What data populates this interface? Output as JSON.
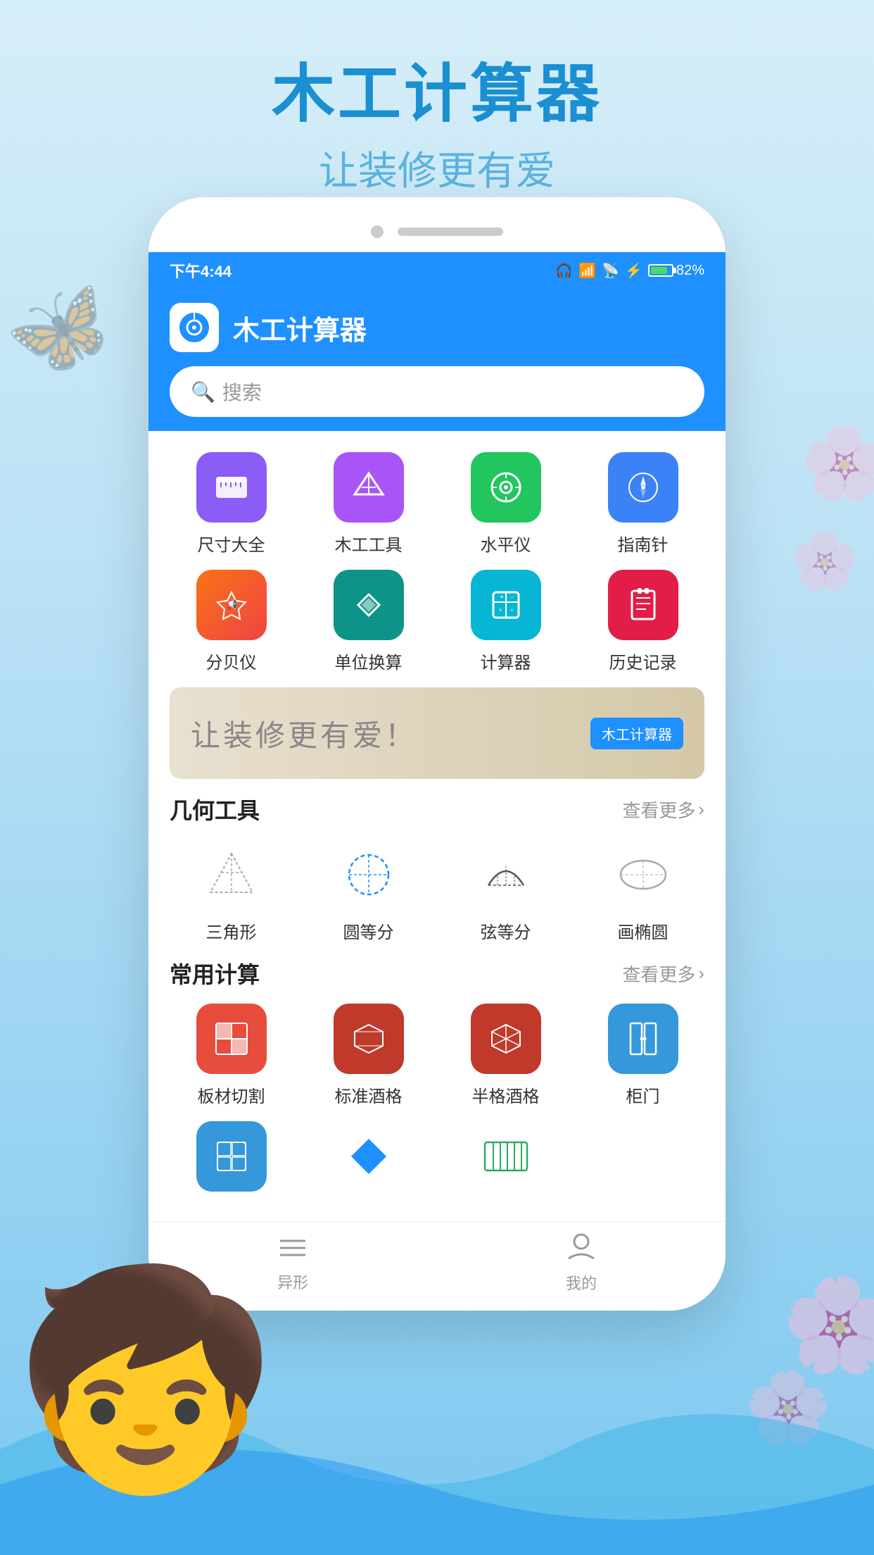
{
  "app": {
    "main_title": "木工计算器",
    "sub_title": "让装修更有爱",
    "logo_emoji": "🔵",
    "app_name": "木工计算器"
  },
  "status_bar": {
    "time": "下午4:44",
    "battery_percent": "82%"
  },
  "search": {
    "placeholder": "搜索"
  },
  "tools_row1": [
    {
      "label": "尺寸大全",
      "color": "purple",
      "emoji": "📏"
    },
    {
      "label": "木工工具",
      "color": "violet",
      "emoji": "📐"
    },
    {
      "label": "水平仪",
      "color": "green",
      "emoji": "🎯"
    },
    {
      "label": "指南针",
      "color": "blue",
      "emoji": "🧭"
    }
  ],
  "tools_row2": [
    {
      "label": "分贝仪",
      "color": "orange",
      "emoji": "📢"
    },
    {
      "label": "单位换算",
      "color": "teal",
      "emoji": "🔺"
    },
    {
      "label": "计算器",
      "color": "cyan",
      "emoji": "🔢"
    },
    {
      "label": "历史记录",
      "color": "red",
      "emoji": "📋"
    }
  ],
  "banner": {
    "text": "让装修更有爱！",
    "badge": "木工计算器"
  },
  "geo_section": {
    "title": "几何工具",
    "more": "查看更多"
  },
  "geo_tools": [
    {
      "label": "三角形",
      "emoji": "◈"
    },
    {
      "label": "圆等分",
      "emoji": "◌"
    },
    {
      "label": "弦等分",
      "emoji": "⌒"
    },
    {
      "label": "画椭圆",
      "emoji": "⬬"
    }
  ],
  "calc_section": {
    "title": "常用计算",
    "more": "查看更多"
  },
  "calc_tools_row1": [
    {
      "label": "板材切割",
      "color": "#e74c3c",
      "emoji": "▦"
    },
    {
      "label": "标准酒格",
      "color": "#c0392b",
      "emoji": "✦"
    },
    {
      "label": "半格酒格",
      "color": "#c0392b",
      "emoji": "✧"
    },
    {
      "label": "柜门",
      "color": "#3498db",
      "emoji": "▯"
    }
  ],
  "calc_tools_row2": [
    {
      "label": "",
      "color": "#3498db",
      "emoji": "⬛"
    },
    {
      "label": "",
      "color": "#3498db",
      "emoji": "◆"
    },
    {
      "label": "",
      "color": "#27ae60",
      "emoji": "▤"
    },
    {
      "label": "",
      "color": "#aaa",
      "emoji": ""
    }
  ],
  "tabs": [
    {
      "label": "异形",
      "active": false
    },
    {
      "label": "我的",
      "active": false
    }
  ]
}
